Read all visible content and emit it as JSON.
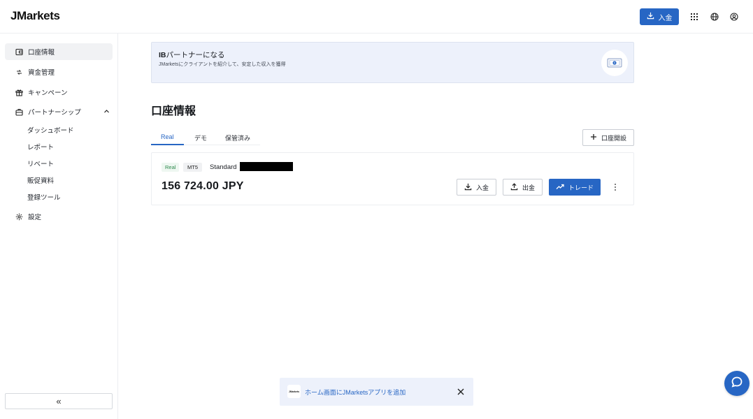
{
  "app": {
    "logo": "JMarkets"
  },
  "header": {
    "deposit_label": "入金",
    "icons": [
      "apps-grid-icon",
      "globe-icon",
      "user-account-icon"
    ]
  },
  "sidebar": {
    "items": [
      {
        "label": "口座情報",
        "icon": "wallet-icon",
        "active": true
      },
      {
        "label": "資金管理",
        "icon": "transfer-icon",
        "active": false
      },
      {
        "label": "キャンペーン",
        "icon": "gift-icon",
        "active": false
      },
      {
        "label": "パートナーシップ",
        "icon": "briefcase-icon",
        "active": false,
        "expanded": true
      }
    ],
    "partnership_subitems": [
      "ダッシュボード",
      "レポート",
      "リベート",
      "販促資料",
      "登録ツール"
    ],
    "settings_label": "設定",
    "collapse_label": "«"
  },
  "banner": {
    "title_bold": "IB",
    "title_rest": "パートナーになる",
    "subtitle": "JMarketsにクライアントを紹介して、安定した収入を獲得"
  },
  "main": {
    "page_title": "口座情報",
    "tabs": [
      {
        "label": "Real",
        "active": true
      },
      {
        "label": "デモ",
        "active": false
      },
      {
        "label": "保管済み",
        "active": false
      }
    ],
    "open_account_label": "口座開設"
  },
  "account": {
    "badge_type": "Real",
    "badge_platform": "MT5",
    "account_type": "Standard",
    "balance": "156 724.00 JPY",
    "deposit_label": "入金",
    "withdraw_label": "出金",
    "trade_label": "トレード"
  },
  "toast": {
    "logo_text": "JMarkets",
    "text": "ホーム画面にJMarketsアプリを追加"
  },
  "colors": {
    "accent": "#2766c4",
    "banner_bg": "#edf1fb",
    "real_badge_bg": "#eef7f1",
    "real_badge_text": "#2f8a4e"
  }
}
